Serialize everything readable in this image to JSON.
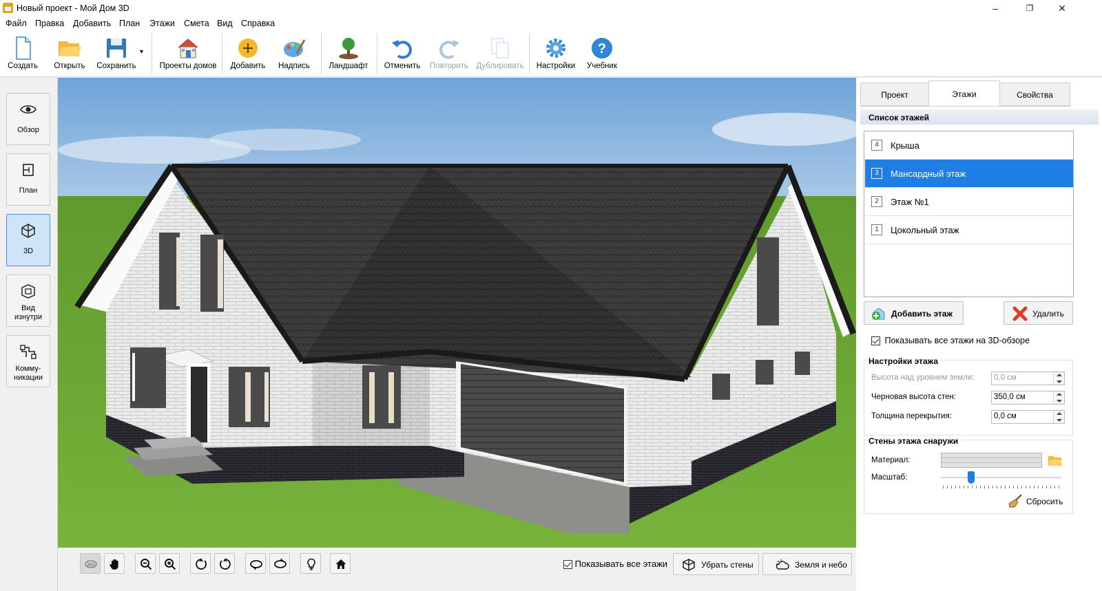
{
  "window": {
    "title": "Новый проект - Мой Дом 3D",
    "minimize": "–",
    "maximize": "❐",
    "close": "✕"
  },
  "menu": [
    "Файл",
    "Правка",
    "Добавить",
    "План",
    "Этажи",
    "Смета",
    "Вид",
    "Справка"
  ],
  "toolbar": {
    "create": "Создать",
    "open": "Открыть",
    "save": "Сохранить",
    "projects": "Проекты домов",
    "add": "Добавить",
    "label": "Надпись",
    "landscape": "Ландшафт",
    "undo": "Отменить",
    "redo": "Повторить",
    "duplicate": "Дублировать",
    "settings": "Настройки",
    "tutorial": "Учебник",
    "save_dropdown": "▾"
  },
  "left_nav": {
    "overview": "Обзор",
    "plan": "План",
    "view3d": "3D",
    "inside_line1": "Вид",
    "inside_line2": "изнутри",
    "comm_line1": "Комму-",
    "comm_line2": "никации",
    "active": "3D"
  },
  "bottom": {
    "show_all_floors": "Показывать все этажи",
    "remove_walls": "Убрать стены",
    "ground_sky": "Земля и небо",
    "show_all_checked": true,
    "rotate360": "360"
  },
  "right": {
    "tabs": [
      "Проект",
      "Этажи",
      "Свойства"
    ],
    "active_tab": "Этажи",
    "floors_header": "Список этажей",
    "floors": [
      {
        "num": "4",
        "name": "Крыша"
      },
      {
        "num": "3",
        "name": "Мансардный этаж"
      },
      {
        "num": "2",
        "name": "Этаж №1"
      },
      {
        "num": "1",
        "name": "Цокольный этаж"
      }
    ],
    "selected_floor": "Мансардный этаж",
    "add_floor": "Добавить этаж",
    "delete": "Удалить",
    "show_all_3d": "Показывать все этажи на 3D-обзоре",
    "show_all_3d_checked": true,
    "settings_title": "Настройки этажа",
    "height_above_ground_label": "Высота над уровнем земли:",
    "height_above_ground": "0,0 см",
    "wall_height_label": "Черновая высота стен:",
    "wall_height": "350,0 см",
    "slab_thickness_label": "Толщина перекрытия:",
    "slab_thickness": "0,0 см",
    "walls_title": "Стены этажа снаружи",
    "material_label": "Материал:",
    "scale_label": "Масштаб:",
    "scale_value": 0.25,
    "reset": "Сбросить"
  }
}
